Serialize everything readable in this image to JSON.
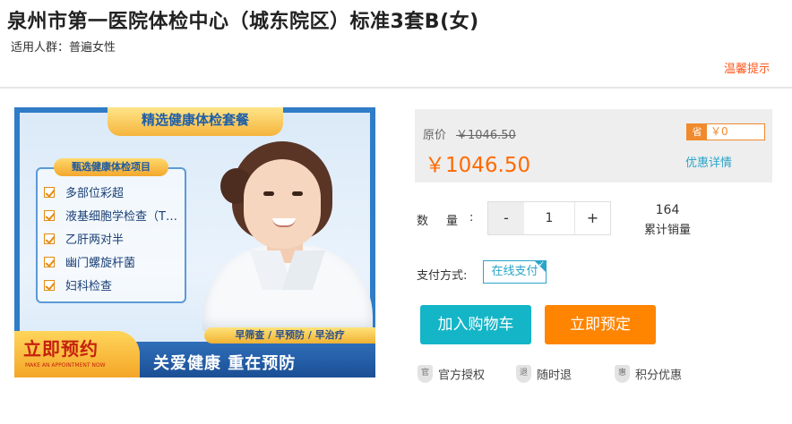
{
  "header": {
    "title": "泉州市第一医院体检中心（城东院区）标准3套B(女)",
    "audience": "适用人群：普遍女性",
    "tip": "温馨提示"
  },
  "banner": {
    "ribbon": "精选健康体检套餐",
    "list_title": "甄选健康体检项目",
    "items": [
      "多部位彩超",
      "液基细胞学检查（T…",
      "乙肝两对半",
      "幽门螺旋杆菌",
      "妇科检查"
    ],
    "badge_strip": "早筛查 / 早预防 / 早治疗",
    "cta": "立即预约",
    "cta_en": "MAKE AN APPOINTMENT NOW",
    "slogan": "关爱健康  重在预防"
  },
  "pricing": {
    "original_label": "原价",
    "original_price": "￥1046.50",
    "current_price": "￥1046.50",
    "save_tag": "省",
    "save_value": "￥0",
    "discount_link": "优惠详情"
  },
  "quantity": {
    "label": "数量",
    "colon": ":",
    "minus": "-",
    "value": "1",
    "plus": "+"
  },
  "sales": {
    "count": "164",
    "label": "累计销量"
  },
  "payment": {
    "label": "支付方式:",
    "option": "在线支付",
    "check": "✓"
  },
  "actions": {
    "add_to_cart": "加入购物车",
    "book_now": "立即预定"
  },
  "assurances": [
    {
      "icon": "官",
      "label": "官方授权"
    },
    {
      "icon": "退",
      "label": "随时退"
    },
    {
      "icon": "惠",
      "label": "积分优惠"
    }
  ],
  "colors": {
    "accent_orange": "#ff6a00",
    "cart_teal": "#13b5c7",
    "book_orange": "#ff8400",
    "link_blue": "#2aa5c9"
  }
}
